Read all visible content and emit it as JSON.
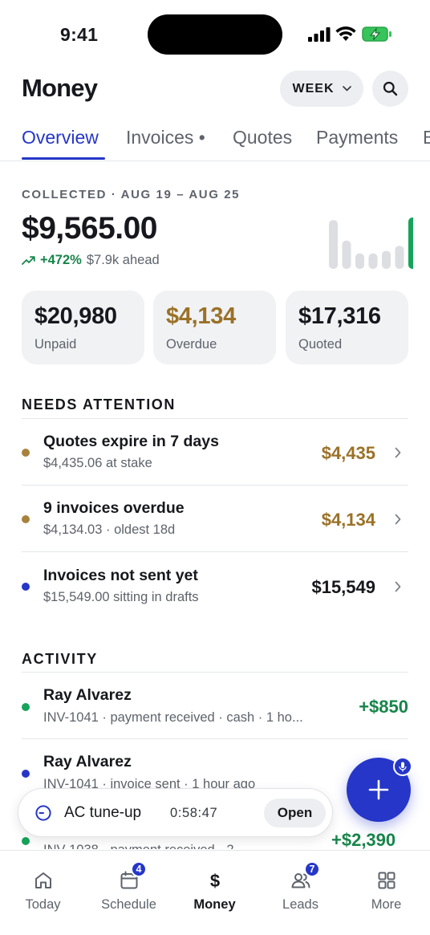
{
  "status_bar": {
    "time": "9:41"
  },
  "header": {
    "title": "Money",
    "period_label": "WEEK"
  },
  "tabs": [
    {
      "label": "Overview",
      "active": true
    },
    {
      "label": "Invoices •",
      "active": false
    },
    {
      "label": "Quotes",
      "active": false
    },
    {
      "label": "Payments",
      "active": false
    },
    {
      "label": "B",
      "active": false
    }
  ],
  "collected": {
    "label": "COLLECTED · AUG 19 – AUG 25",
    "amount": "$9,565.00",
    "trend_pct": "+472%",
    "trend_note": "$7.9k ahead",
    "trend_icon": "trend-up-icon",
    "bar_levels": [
      0.95,
      0.55,
      0.3,
      0.3,
      0.35,
      0.45,
      1.0
    ]
  },
  "stats": [
    {
      "value": "$20,980",
      "label": "Unpaid",
      "color": "#16181d"
    },
    {
      "value": "$4,134",
      "label": "Overdue",
      "color": "#9a7127"
    },
    {
      "value": "$17,316",
      "label": "Quoted",
      "color": "#16181d"
    }
  ],
  "needs_attention": {
    "title": "NEEDS ATTENTION",
    "items": [
      {
        "title": "Quotes expire in 7 days",
        "subtitle": "$4,435.06 at stake",
        "amount": "$4,435",
        "dot_color": "#a8823c",
        "amount_color": "#9a7127"
      },
      {
        "title": "9 invoices overdue",
        "subtitle": "$4,134.03 · oldest 18d",
        "amount": "$4,134",
        "dot_color": "#a8823c",
        "amount_color": "#9a7127"
      },
      {
        "title": "Invoices not sent yet",
        "subtitle": "$15,549.00 sitting in drafts",
        "amount": "$15,549",
        "dot_color": "#2536c9",
        "amount_color": "#16181d"
      }
    ]
  },
  "activity": {
    "title": "ACTIVITY",
    "items": [
      {
        "title": "Ray Alvarez",
        "subtitle": "INV-1041 · payment received · cash · 1 ho...",
        "amount": "+$850",
        "dot_color": "#17a35a"
      },
      {
        "title": "Ray Alvarez",
        "subtitle": "INV-1041 · invoice sent · 1 hour ago",
        "amount": "",
        "dot_color": "#2536c9"
      },
      {
        "title": "",
        "subtitle": "INV-1038 · payment received · 2",
        "amount": "+$2,390",
        "dot_color": "#17a35a"
      }
    ]
  },
  "timer": {
    "label": "AC tune-up",
    "elapsed": "0:58:47",
    "action": "Open"
  },
  "fab": {
    "icon": "plus-icon",
    "badge_icon": "mic-icon"
  },
  "bottom_nav": [
    {
      "label": "Today",
      "icon": "home-icon",
      "badge": "",
      "active": false
    },
    {
      "label": "Schedule",
      "icon": "calendar-icon",
      "badge": "4",
      "active": false
    },
    {
      "label": "Money",
      "icon": "dollar-icon",
      "badge": "",
      "active": true
    },
    {
      "label": "Leads",
      "icon": "people-icon",
      "badge": "7",
      "active": false
    },
    {
      "label": "More",
      "icon": "grid-icon",
      "badge": "",
      "active": false
    }
  ]
}
